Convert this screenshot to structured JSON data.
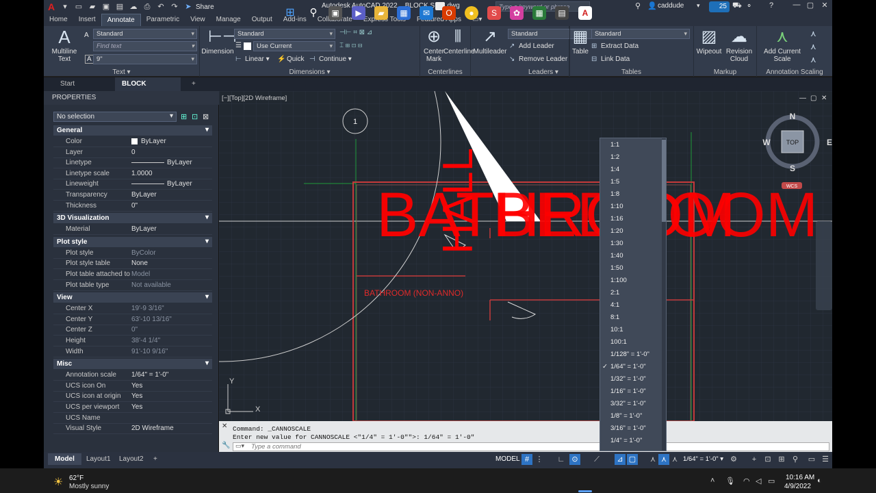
{
  "window": {
    "app_title": "Autodesk AutoCAD 2022",
    "file_name": "BLOCK SIZE.dwg",
    "share_label": "Share",
    "search_placeholder": "Type a keyword or phrase",
    "user": "caddude",
    "badge_count": "25"
  },
  "ribbon_tabs": [
    "Home",
    "Insert",
    "Annotate",
    "Parametric",
    "View",
    "Manage",
    "Output",
    "Add-ins",
    "Collaborate",
    "Express Tools",
    "Featured Apps"
  ],
  "ribbon": {
    "text_panel": {
      "multiline_text": "Multiline Text",
      "style_value": "Standard",
      "find_placeholder": "Find text",
      "height_value": "9\"",
      "title": "Text"
    },
    "dimensions_panel": {
      "dimension": "Dimension",
      "style_value": "Standard",
      "layer_value": "Use Current",
      "linear": "Linear",
      "quick": "Quick",
      "continue": "Continue",
      "title": "Dimensions"
    },
    "centerlines_panel": {
      "center_mark": "Center Mark",
      "centerline": "Centerline",
      "title": "Centerlines"
    },
    "leaders_panel": {
      "multileader": "Multileader",
      "style_value": "Standard",
      "add_leader": "Add Leader",
      "remove_leader": "Remove Leader",
      "title": "Leaders"
    },
    "tables_panel": {
      "table": "Table",
      "style_value": "Standard",
      "extract_data": "Extract Data",
      "link_data": "Link Data",
      "title": "Tables"
    },
    "markup_panel": {
      "wipeout": "Wipeout",
      "revision_cloud": "Revision Cloud",
      "title": "Markup"
    },
    "scaling_panel": {
      "add_scale": "Add Current Scale",
      "title": "Annotation Scaling"
    }
  },
  "doc_tabs": {
    "start": "Start",
    "active": "BLOCK SIZE*"
  },
  "properties": {
    "header": "PROPERTIES",
    "selection": "No selection",
    "sections": {
      "general": "General",
      "viz3d": "3D Visualization",
      "plot_style": "Plot style",
      "view": "View",
      "misc": "Misc"
    },
    "general_rows": [
      {
        "k": "Color",
        "v": "ByLayer"
      },
      {
        "k": "Layer",
        "v": "0"
      },
      {
        "k": "Linetype",
        "v": "ByLayer"
      },
      {
        "k": "Linetype scale",
        "v": "1.0000"
      },
      {
        "k": "Lineweight",
        "v": "ByLayer"
      },
      {
        "k": "Transparency",
        "v": "ByLayer"
      },
      {
        "k": "Thickness",
        "v": "0\""
      }
    ],
    "viz_rows": [
      {
        "k": "Material",
        "v": "ByLayer"
      }
    ],
    "plot_rows": [
      {
        "k": "Plot style",
        "v": "ByColor"
      },
      {
        "k": "Plot style table",
        "v": "None"
      },
      {
        "k": "Plot table attached to",
        "v": "Model"
      },
      {
        "k": "Plot table type",
        "v": "Not available"
      }
    ],
    "view_rows": [
      {
        "k": "Center X",
        "v": "19'-9 3/16\""
      },
      {
        "k": "Center Y",
        "v": "63'-10 13/16\""
      },
      {
        "k": "Center Z",
        "v": "0\""
      },
      {
        "k": "Height",
        "v": "38'-4 1/4\""
      },
      {
        "k": "Width",
        "v": "91'-10 9/16\""
      }
    ],
    "misc_rows": [
      {
        "k": "Annotation scale",
        "v": "1/64\" = 1'-0\""
      },
      {
        "k": "UCS icon On",
        "v": "Yes"
      },
      {
        "k": "UCS icon at origin",
        "v": "Yes"
      },
      {
        "k": "UCS per viewport",
        "v": "Yes"
      },
      {
        "k": "UCS Name",
        "v": ""
      },
      {
        "k": "Visual Style",
        "v": "2D Wireframe"
      }
    ]
  },
  "viewport": {
    "label": "[−][Top][2D Wireframe]",
    "circle_tag": "1",
    "red_big_text_1": "BATHROOM",
    "red_big_text_2": "BEDROOM",
    "red_vertical_text": "HALL",
    "non_anno_text": "BATHROOM (NON-ANNO)",
    "viewcube": {
      "n": "N",
      "s": "S",
      "e": "E",
      "w": "W",
      "top": "TOP",
      "wcs": "WCS"
    },
    "ucs_x": "X",
    "ucs_y": "Y"
  },
  "command": {
    "line1": "Command: _CANNOSCALE",
    "line2": "Enter new value for CANNOSCALE <\"1/4\" = 1'-0\"\">: 1/64\" = 1'-0\"",
    "placeholder": "Type a command"
  },
  "layout_tabs": [
    "Model",
    "Layout1",
    "Layout2"
  ],
  "status": {
    "model": "MODEL",
    "scale": "1/64\" = 1'-0\""
  },
  "scale_list": {
    "items": [
      "1:1",
      "1:2",
      "1:4",
      "1:5",
      "1:8",
      "1:10",
      "1:16",
      "1:20",
      "1:30",
      "1:40",
      "1:50",
      "1:100",
      "2:1",
      "4:1",
      "8:1",
      "10:1",
      "100:1",
      "1/128\" = 1'-0\"",
      "1/64\" = 1'-0\"",
      "1/32\" = 1'-0\"",
      "1/16\" = 1'-0\"",
      "3/32\" = 1'-0\"",
      "1/8\" = 1'-0\"",
      "3/16\" = 1'-0\"",
      "1/4\" = 1'-0\""
    ],
    "checked": "1/64\" = 1'-0\""
  },
  "taskbar": {
    "temp": "62°F",
    "condition": "Mostly sunny",
    "time": "10:16 AM",
    "date": "4/9/2022"
  },
  "colors": {
    "ribbon": "#333c4c",
    "canvas": "#212830",
    "red": "#ff0000",
    "accent": "#2e74c4"
  }
}
